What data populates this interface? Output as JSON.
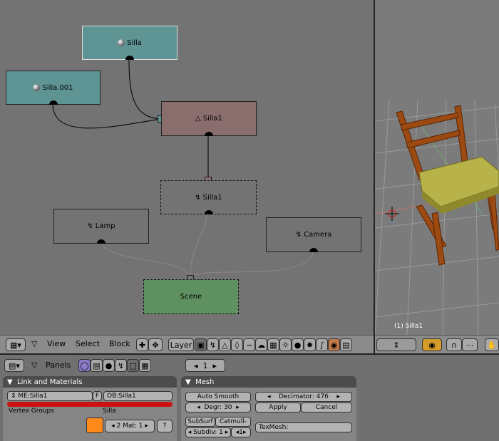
{
  "oops": {
    "nodes": {
      "silla": "Silla",
      "silla001": "Silla.001",
      "silla1_ob": "Silla1",
      "silla1_mesh": "Silla1",
      "lamp": "Lamp",
      "camera": "Camera",
      "scene": "Scene"
    }
  },
  "view3d": {
    "object_label": "(1) Silla1"
  },
  "header": {
    "menus": [
      "View",
      "Select",
      "Block"
    ],
    "layer_label": "Layer",
    "icons": [
      "editor-type-icon",
      "view-icon",
      "select-icon",
      "zoom-icon",
      "pan-icon",
      "layer-icon",
      "image-icon",
      "curve-icon",
      "armature-icon",
      "mesh-icon",
      "lattice-icon",
      "lamp-icon",
      "sphere-icon",
      "material-icon",
      "texture-icon",
      "ipo-icon",
      "text-icon",
      "render-icon"
    ]
  },
  "buttons": {
    "panels_label": "Panels",
    "frame_value": "1",
    "link_materials": {
      "title": "Link and Materials",
      "me_field": "ME:Silla1",
      "f_label": "F",
      "ob_field": "OB:Silla1",
      "vertex_groups": "Vertex Groups",
      "material_name": "Silla",
      "mat_field": "2 Mat: 1",
      "question": "?",
      "color_swatch": "#ff8a1c"
    },
    "mesh": {
      "title": "Mesh",
      "auto_smooth": "Auto Smooth",
      "degr": "Degr: 30",
      "decimator": "Decimator: 476",
      "apply": "Apply",
      "cancel": "Cancel",
      "subsurf": "SubSurf",
      "catmull": "Catmull-",
      "subdiv": "Subdiv: 1",
      "subdiv_render": "1",
      "texmesh": "TexMesh:"
    }
  },
  "colors": {
    "object_node": "#5f9494",
    "selected_object_node": "#8a6e6e",
    "scene_node": "#5f9060",
    "red_bar": "#cc1111"
  }
}
